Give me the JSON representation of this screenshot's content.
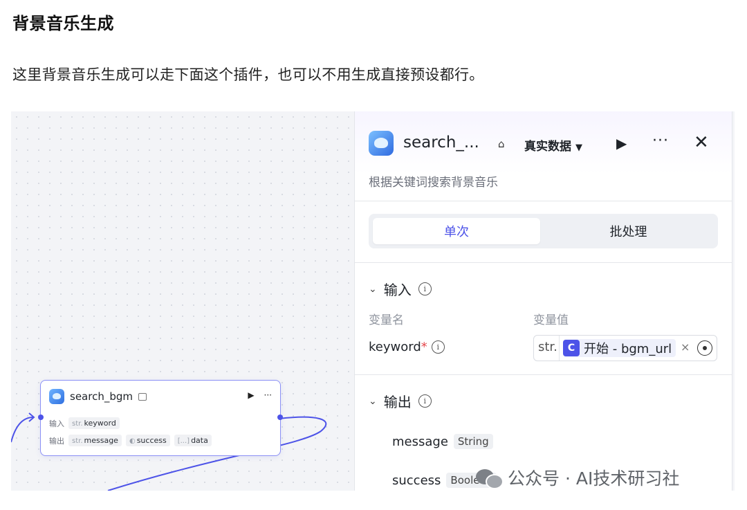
{
  "article": {
    "title": "背景音乐生成",
    "paragraph": "这里背景音乐生成可以走下面这个插件，也可以不用生成直接预设都行。"
  },
  "node": {
    "name": "search_bgm",
    "input_label": "输入",
    "input_param_type": "str.",
    "input_param": "keyword",
    "output_label": "输出",
    "outputs": [
      {
        "type": "str.",
        "name": "message"
      },
      {
        "type": "",
        "name": "success"
      },
      {
        "type": "[...]",
        "name": "data"
      }
    ]
  },
  "panel": {
    "title": "search_...",
    "data_mode": "真实数据",
    "description": "根据关键词搜索背景音乐",
    "tabs": [
      {
        "label": "单次",
        "active": true
      },
      {
        "label": "批处理",
        "active": false
      }
    ],
    "input_section": {
      "title": "输入",
      "col_name": "变量名",
      "col_value": "变量值",
      "param_name": "keyword",
      "required_mark": "*",
      "value_type": "str.",
      "ref_icon": "C",
      "ref_text": "开始 - bgm_url"
    },
    "output_section": {
      "title": "输出",
      "items": [
        {
          "name": "message",
          "type": "String"
        },
        {
          "name": "success",
          "type": "Boolean"
        }
      ]
    }
  },
  "watermark": {
    "text": "公众号 · AI技术研习社"
  },
  "colors": {
    "accent": "#4d53e8",
    "node_border": "#8a8ff5",
    "required": "#e5484d"
  }
}
